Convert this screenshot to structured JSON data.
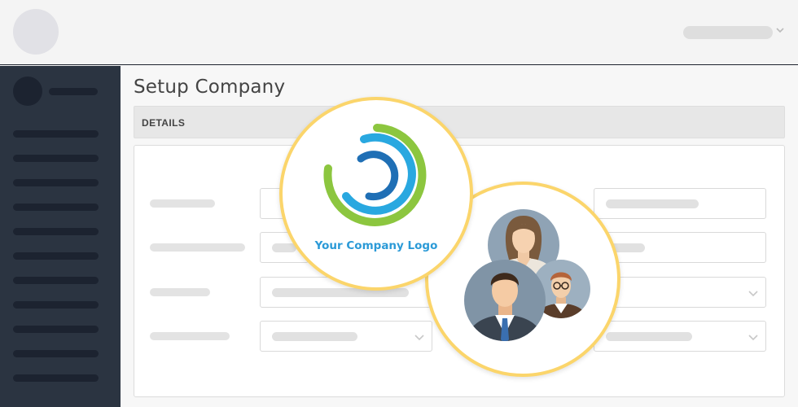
{
  "page": {
    "title": "Setup Company",
    "section": "DETAILS"
  },
  "logo_card": {
    "caption": "Your Company Logo",
    "icon": "ring-logo-icon",
    "colors": {
      "outer": "#8cc63f",
      "middle": "#29a8e0",
      "inner": "#1f6fb5"
    }
  },
  "team_card": {
    "icon": "team-avatars-icon"
  },
  "colors": {
    "sidebar": "#2b3441",
    "accent_border": "#fbd56b",
    "caption": "#2b9ad7"
  }
}
